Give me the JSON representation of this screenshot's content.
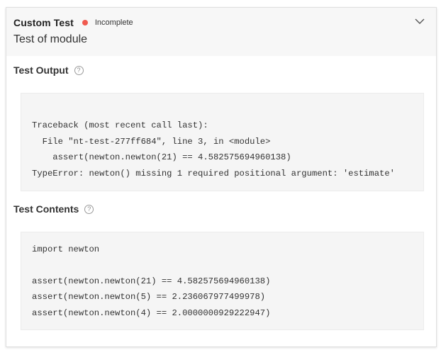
{
  "header": {
    "test_name": "Custom Test",
    "status": "Incomplete",
    "status_color": "#f05a4f",
    "description": "Test of module",
    "collapse_icon": "chevron-down-icon"
  },
  "output_section": {
    "title": "Test Output",
    "help_icon": "help-circle-icon",
    "help_glyph": "?",
    "lines": [
      "Traceback (most recent call last):",
      "  File \"nt-test-277ff684\", line 3, in <module>",
      "    assert(newton.newton(21) == 4.582575694960138)",
      "TypeError: newton() missing 1 required positional argument: 'estimate'"
    ]
  },
  "contents_section": {
    "title": "Test Contents",
    "help_icon": "help-circle-icon",
    "help_glyph": "?",
    "lines": [
      "import newton",
      "",
      "assert(newton.newton(21) == 4.582575694960138)",
      "assert(newton.newton(5) == 2.236067977499978)",
      "assert(newton.newton(4) == 2.0000000929222947)"
    ]
  }
}
